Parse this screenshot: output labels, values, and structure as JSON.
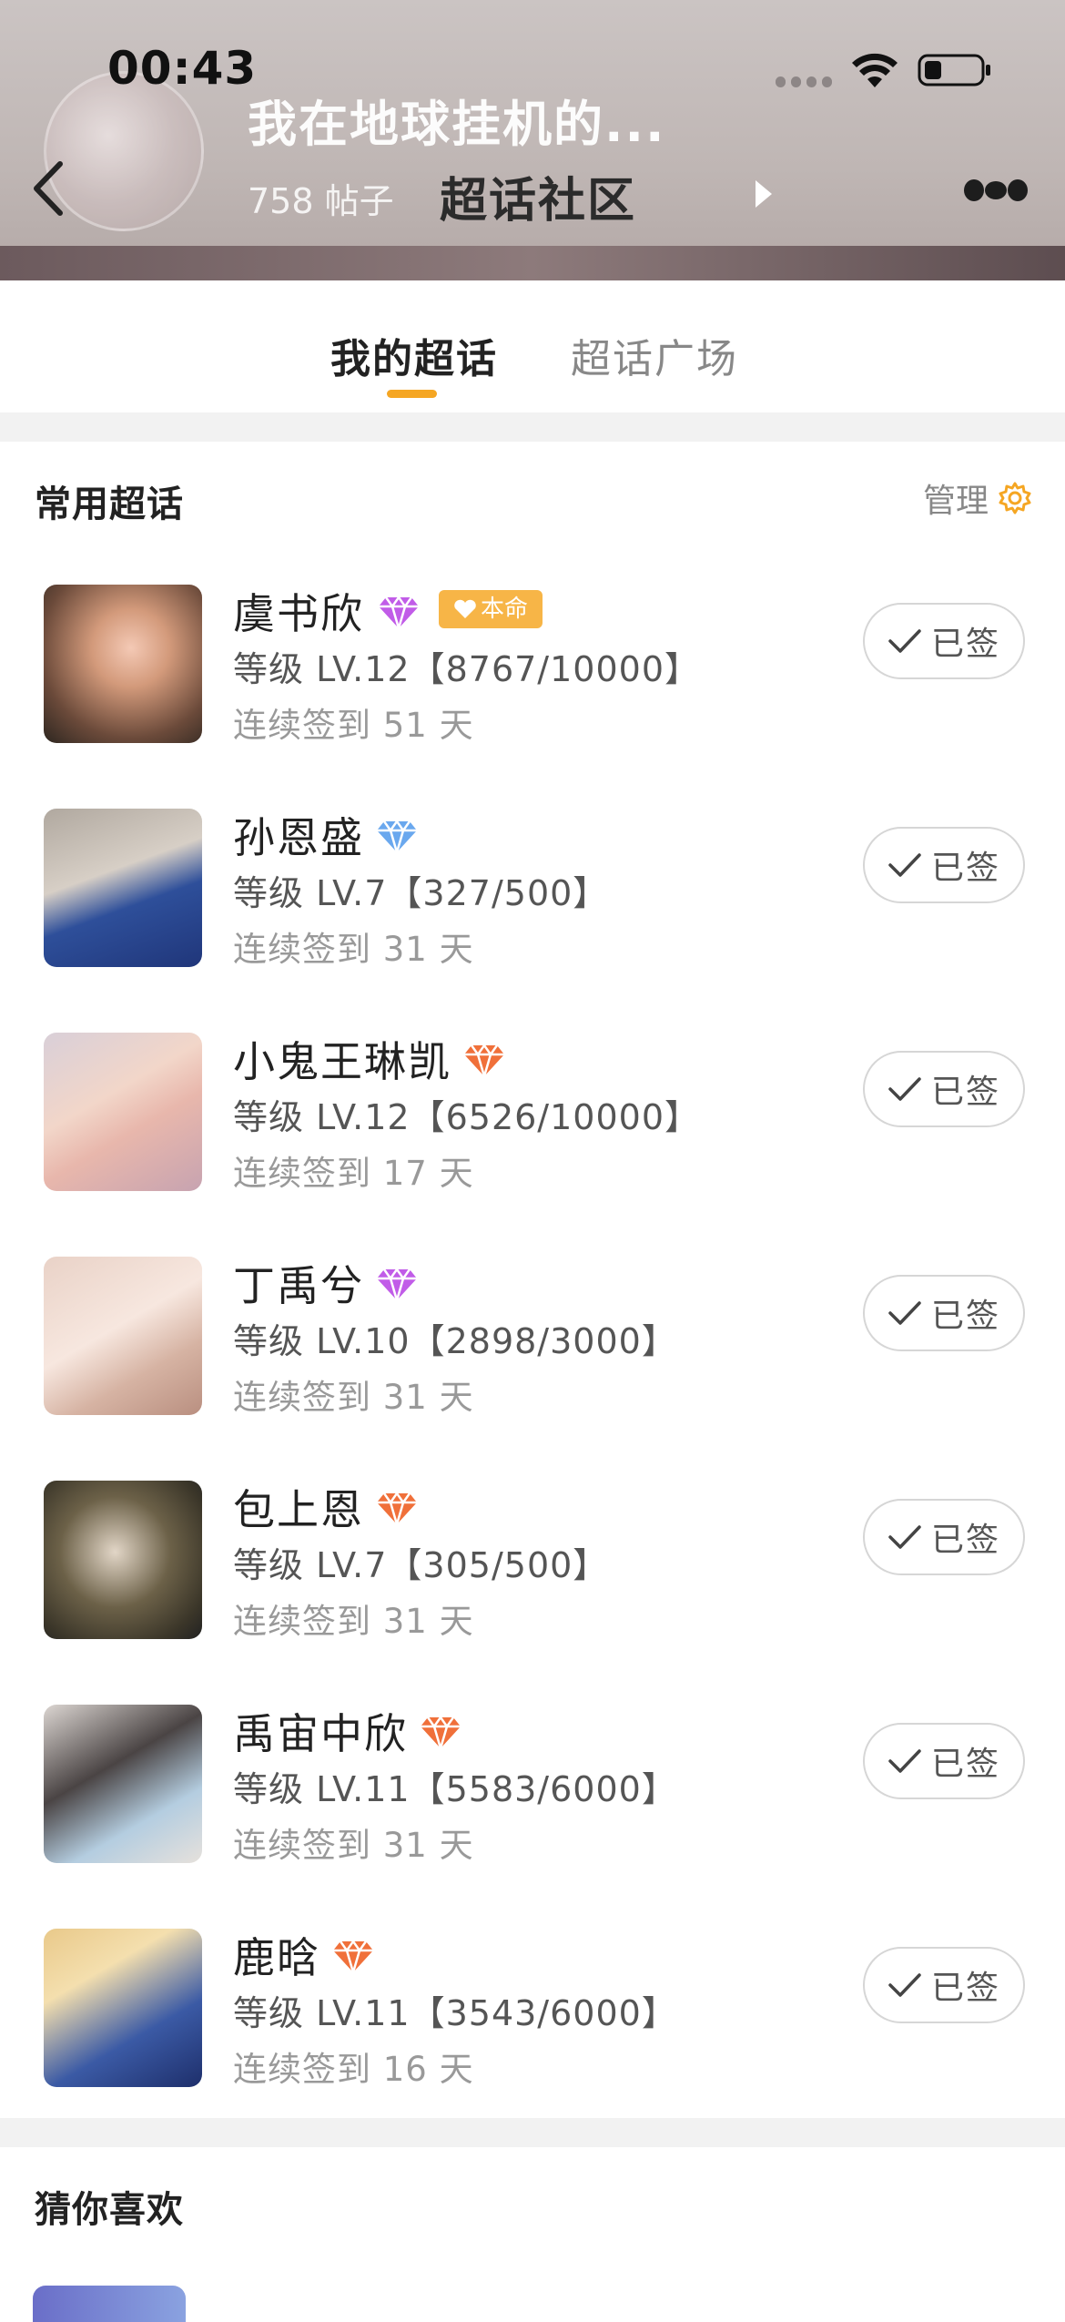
{
  "status_bar": {
    "time": "00:43"
  },
  "header": {
    "topic_title": "我在地球挂机的...",
    "post_count": "758 帖子",
    "nav_title": "超话社区"
  },
  "tabs": [
    {
      "label": "我的超话",
      "active": true
    },
    {
      "label": "超话广场",
      "active": false
    }
  ],
  "frequent_section": {
    "title": "常用超话",
    "manage_label": "管理"
  },
  "signed_label": "已签",
  "benming_label": "本命",
  "topics": [
    {
      "name": "虞书欣",
      "badge": "purple",
      "level": "等级 LV.12【8767/10000】",
      "streak": "连续签到 51 天",
      "benming": true
    },
    {
      "name": "孙恩盛",
      "badge": "blue",
      "level": "等级 LV.7【327/500】",
      "streak": "连续签到 31 天",
      "benming": false
    },
    {
      "name": "小鬼王琳凯",
      "badge": "orange",
      "level": "等级 LV.12【6526/10000】",
      "streak": "连续签到 17 天",
      "benming": false
    },
    {
      "name": "丁禹兮",
      "badge": "purple",
      "level": "等级 LV.10【2898/3000】",
      "streak": "连续签到 31 天",
      "benming": false
    },
    {
      "name": "包上恩",
      "badge": "orange",
      "level": "等级 LV.7【305/500】",
      "streak": "连续签到 31 天",
      "benming": false
    },
    {
      "name": "禹宙中欣",
      "badge": "orange",
      "level": "等级 LV.11【5583/6000】",
      "streak": "连续签到 31 天",
      "benming": false
    },
    {
      "name": "鹿晗",
      "badge": "orange",
      "level": "等级 LV.11【3543/6000】",
      "streak": "连续签到 16 天",
      "benming": false
    }
  ],
  "guess_section": {
    "title": "猜你喜欢"
  },
  "colors": {
    "accent": "#f5a623",
    "badge_purple": "#b54fe0",
    "badge_blue": "#6aa8ee",
    "badge_orange": "#f0703a",
    "benming_bg": "#f7b547"
  }
}
